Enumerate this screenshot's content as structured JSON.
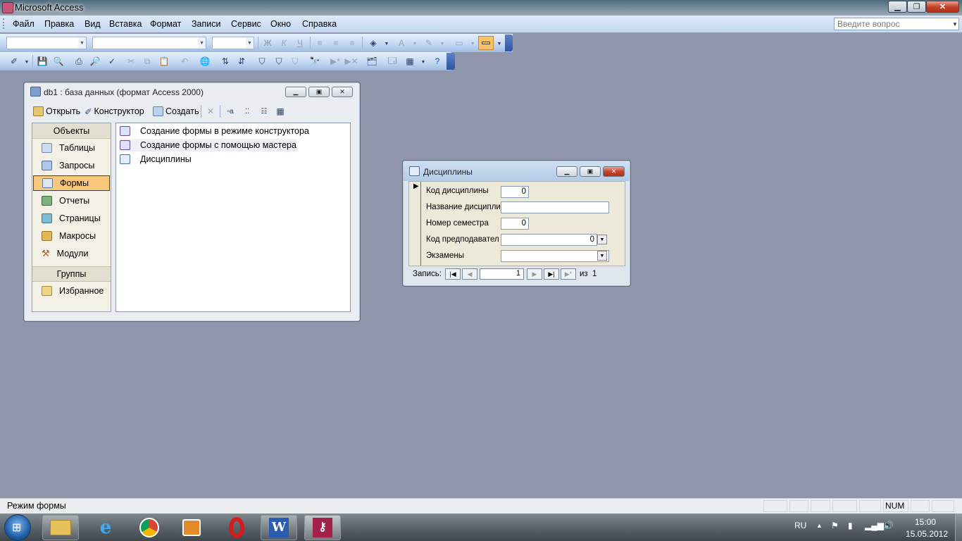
{
  "app": {
    "title": "Microsoft Access"
  },
  "menu": [
    "Файл",
    "Правка",
    "Вид",
    "Вставка",
    "Формат",
    "Записи",
    "Сервис",
    "Окно",
    "Справка"
  ],
  "help": {
    "placeholder": "Введите вопрос"
  },
  "toolbar1": {
    "bold": "Ж",
    "italic": "К",
    "underline": "Ч",
    "font_color": "A"
  },
  "dbwindow": {
    "title": "db1 : база данных (формат Access 2000)",
    "buttons": {
      "open": "Открыть",
      "design": "Конструктор",
      "create": "Создать"
    },
    "objects_header": "Объекты",
    "objects": [
      "Таблицы",
      "Запросы",
      "Формы",
      "Отчеты",
      "Страницы",
      "Макросы",
      "Модули"
    ],
    "selected_object": "Формы",
    "groups_header": "Группы",
    "favorites": "Избранное",
    "list": [
      "Создание формы в режиме конструктора",
      "Создание формы с помощью мастера",
      "Дисциплины"
    ]
  },
  "form": {
    "title": "Дисциплины",
    "fields": [
      {
        "label": "Код дисциплины",
        "value": "0"
      },
      {
        "label": "Название дисципли",
        "value": ""
      },
      {
        "label": "Номер семестра",
        "value": "0"
      },
      {
        "label": "Код предподавател",
        "value": "0"
      },
      {
        "label": "Экзамены",
        "value": ""
      }
    ],
    "nav": {
      "label": "Запись:",
      "current": "1",
      "of": "из",
      "total": "1"
    }
  },
  "status": {
    "text": "Режим формы",
    "num": "NUM"
  },
  "tray": {
    "lang": "RU",
    "time": "15:00",
    "date": "15.05.2012"
  },
  "colors": {
    "selected_object": "#f9c87a",
    "menu_bar": "#c4d8f1",
    "desktop": "#8f96ab"
  }
}
